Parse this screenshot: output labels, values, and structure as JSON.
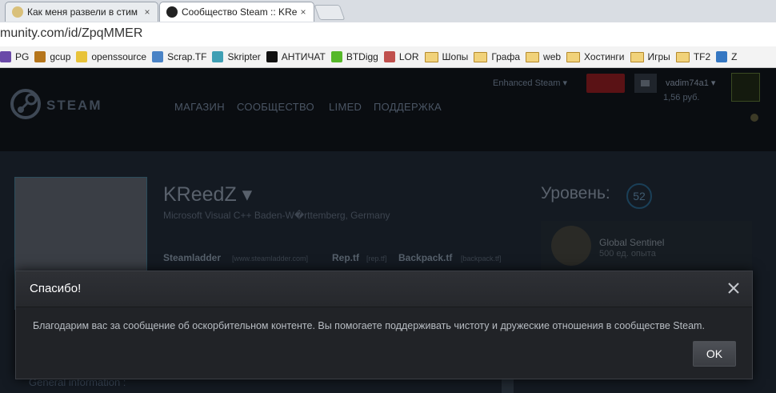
{
  "browser": {
    "tabs": [
      {
        "title": "Как меня развели в стим",
        "close": "×"
      },
      {
        "title": "Сообщество Steam :: KRe",
        "close": "×"
      }
    ],
    "url": "munity.com/id/ZpqMMER",
    "bookmarks": [
      {
        "label": "PG",
        "color": "#6a49a8"
      },
      {
        "label": "gcup",
        "color": "#b5751b"
      },
      {
        "label": "openssource",
        "color": "#e8c33a"
      },
      {
        "label": "Scrap.TF",
        "color": "#4a83c6"
      },
      {
        "label": "Skripter",
        "color": "#3f9fb4"
      },
      {
        "label": "АНТИЧАТ",
        "color": "#111111"
      },
      {
        "label": "BTDigg",
        "color": "#56b82a"
      },
      {
        "label": "LOR",
        "color": "#c0504d"
      },
      {
        "label": "Шопы",
        "folder": true
      },
      {
        "label": "Графа",
        "folder": true
      },
      {
        "label": "web",
        "folder": true
      },
      {
        "label": "Хостинги",
        "folder": true
      },
      {
        "label": "Игры",
        "folder": true
      },
      {
        "label": "TF2",
        "folder": true
      },
      {
        "label": "Z",
        "color": "#3577c2"
      }
    ]
  },
  "steam": {
    "nav": [
      "МАГАЗИН",
      "СООБЩЕСТВО",
      "LIMED",
      "ПОДДЕРЖКА"
    ],
    "enhanced": "Enhanced Steam ▾",
    "username": "vadim74a1 ▾",
    "balance": "1,56 руб."
  },
  "profile": {
    "name": "KReedZ ▾",
    "sub": "Microsoft Visual C++    Baden-W�rttemberg, Germany",
    "links": [
      {
        "name": "Steamladder",
        "url": "[www.steamladder.com]"
      },
      {
        "name": "Rep.tf",
        "url": "[rep.tf]"
      },
      {
        "name": "Backpack.tf",
        "url": "[backpack.tf]"
      }
    ],
    "level_label": "Уровень:",
    "level": "52",
    "badge_name": "Global Sentinel",
    "badge_xp": "500 ед. опыта",
    "general": "General information :"
  },
  "modal": {
    "title": "Спасибо!",
    "message": "Благодарим вас за сообщение об оскорбительном контенте. Вы помогаете поддерживать чистоту и дружеские отношения в сообществе Steam.",
    "ok": "OK"
  }
}
